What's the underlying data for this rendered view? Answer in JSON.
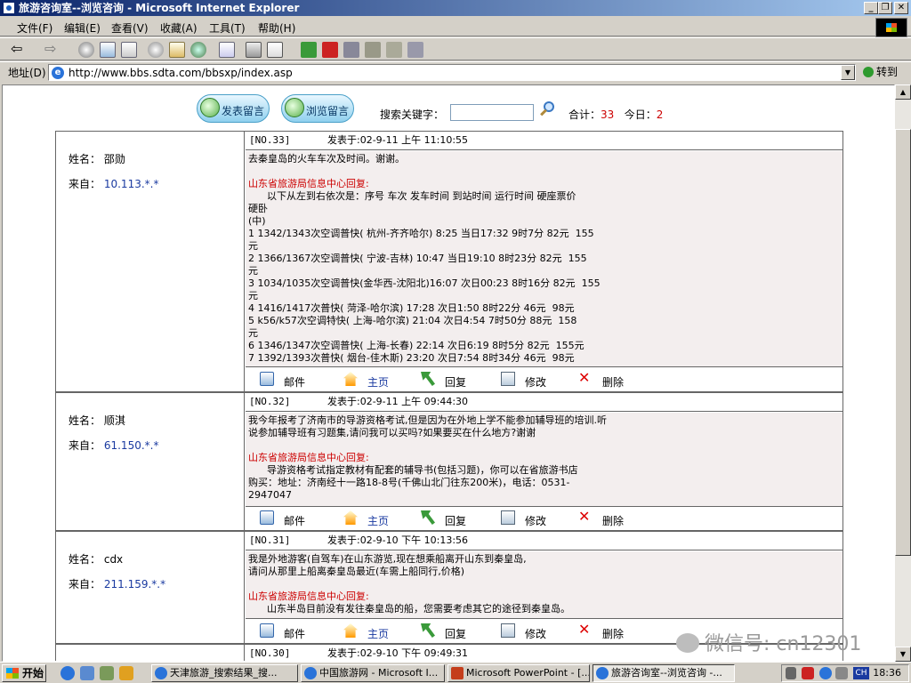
{
  "window": {
    "title": "旅游咨询室--浏览咨询 - Microsoft Internet Explorer",
    "controls": {
      "minimize": "_",
      "restore": "❐",
      "close": "✕"
    }
  },
  "menu": [
    "文件(F)",
    "编辑(E)",
    "查看(V)",
    "收藏(A)",
    "工具(T)",
    "帮助(H)"
  ],
  "address": {
    "label": "地址(D)",
    "url": "http://www.bbs.sdta.com/bbsxp/index.asp",
    "go_label": "转到"
  },
  "page": {
    "post_button": "发表留言",
    "browse_button": "浏览留言",
    "search_label": "搜索关键字：",
    "search_placeholder": "",
    "total_label": "合计：",
    "total_value": "33",
    "today_label": "今日：",
    "today_value": "2"
  },
  "labels": {
    "name": "姓名：",
    "from": "来自：",
    "reply_title": "山东省旅游局信息中心回复:",
    "actions": {
      "mail": "邮件",
      "home": "主页",
      "reply": "回复",
      "edit": "修改",
      "delete": "删除"
    }
  },
  "posts": [
    {
      "no": "[NO.33]",
      "date": "发表于:02-9-11 上午 11:10:55",
      "name": "邵勋",
      "ip": "10.113.*.*",
      "question": "去秦皇岛的火车车次及时间。谢谢。",
      "reply": "      以下从左到右依次是：序号 车次 发车时间 到站时间 运行时间 硬座票价\n硬卧\n(中)\n1 1342/1343次空调普快( 杭州-齐齐哈尔) 8:25 当日17:32 9时7分 82元  155\n元\n2 1366/1367次空调普快( 宁波-吉林) 10:47 当日19:10 8时23分 82元  155\n元\n3 1034/1035次空调普快(金华西-沈阳北)16:07 次日00:23 8时16分 82元  155\n元\n4 1416/1417次普快( 菏泽-哈尔滨) 17:28 次日1:50 8时22分 46元  98元\n5 k56/k57次空调特快( 上海-哈尔滨) 21:04 次日4:54 7时50分 88元  158\n元\n6 1346/1347次空调普快( 上海-长春) 22:14 次日6:19 8时5分 82元  155元\n7 1392/1393次普快( 烟台-佳木斯) 23:20 次日7:54 8时34分 46元  98元"
    },
    {
      "no": "[NO.32]",
      "date": "发表于:02-9-11 上午 09:44:30",
      "name": "顺淇",
      "ip": "61.150.*.*",
      "question": "我今年报考了济南市的导游资格考试,但是因为在外地上学不能参加辅导班的培训.听\n说参加辅导班有习题集,请问我可以买吗?如果要买在什么地方?谢谢",
      "reply": "      导游资格考试指定教材有配套的辅导书(包括习题)，你可以在省旅游书店\n购买：地址：济南经十一路18-8号(千佛山北门往东200米)，电话：0531-\n2947047"
    },
    {
      "no": "[NO.31]",
      "date": "发表于:02-9-10 下午 10:13:56",
      "name": "cdx",
      "ip": "211.159.*.*",
      "question": "我是外地游客(自驾车)在山东游览,现在想乘船离开山东到秦皇岛,\n请问从那里上船离秦皇岛最近(车需上船同行,价格)",
      "reply": "      山东半岛目前没有发往秦皇岛的船，您需要考虑其它的途径到秦皇岛。"
    },
    {
      "no": "[NO.30]",
      "date": "发表于:02-9-10 下午 09:49:31"
    }
  ],
  "taskbar": {
    "start": "开始",
    "tasks": [
      "天津旅游_搜索结果_搜...",
      "中国旅游网 - Microsoft I...",
      "Microsoft PowerPoint - [...",
      "旅游咨询室--浏览咨询 -..."
    ],
    "ime": "CH",
    "clock": "18:36"
  },
  "watermark": "微信号: cn12301"
}
